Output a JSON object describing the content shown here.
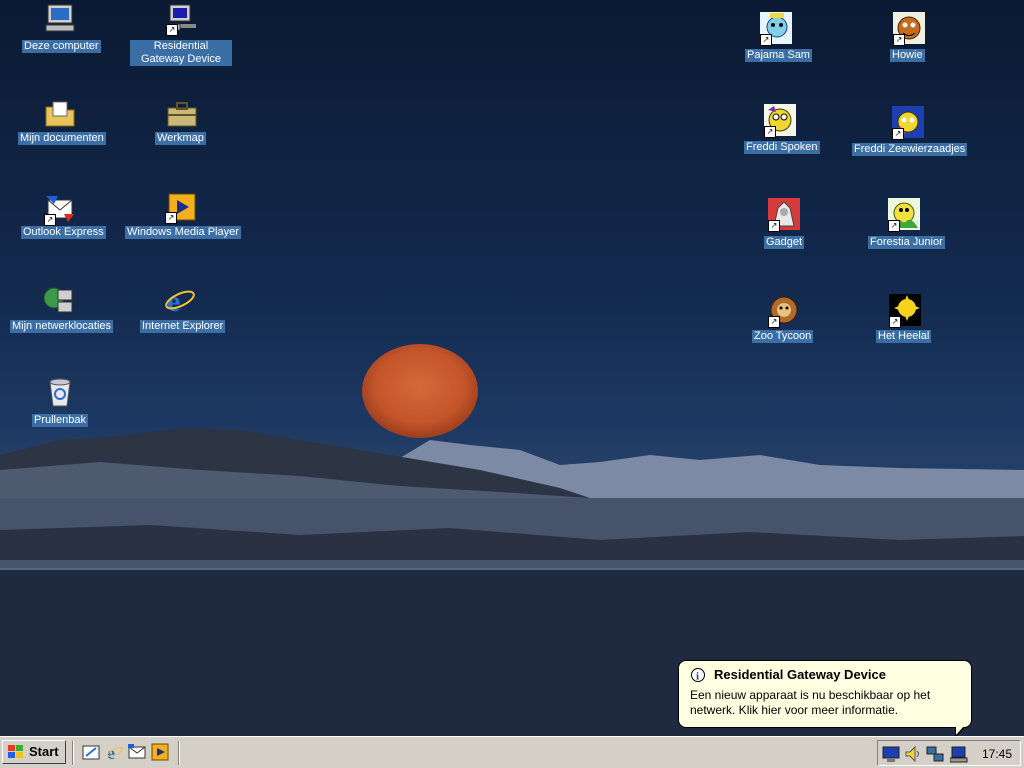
{
  "desktop": {
    "icons": [
      {
        "id": "deze-computer",
        "label": "Deze computer"
      },
      {
        "id": "residential-gateway-device",
        "label": "Residential Gateway Device"
      },
      {
        "id": "mijn-documenten",
        "label": "Mijn documenten"
      },
      {
        "id": "werkmap",
        "label": "Werkmap"
      },
      {
        "id": "outlook-express",
        "label": "Outlook Express"
      },
      {
        "id": "windows-media-player",
        "label": "Windows Media Player"
      },
      {
        "id": "mijn-netwerklocaties",
        "label": "Mijn netwerklocaties"
      },
      {
        "id": "internet-explorer",
        "label": "Internet Explorer"
      },
      {
        "id": "prullenbak",
        "label": "Prullenbak"
      },
      {
        "id": "pajama-sam",
        "label": "Pajama Sam"
      },
      {
        "id": "howie",
        "label": "Howie"
      },
      {
        "id": "freddi-spoken",
        "label": "Freddi Spoken"
      },
      {
        "id": "freddi-zeewierzaadjes",
        "label": "Freddi Zeewierzaadjes"
      },
      {
        "id": "gadget",
        "label": "Gadget"
      },
      {
        "id": "forestia-junior",
        "label": "Forestia Junior"
      },
      {
        "id": "zoo-tycoon",
        "label": "Zoo Tycoon"
      },
      {
        "id": "het-heelal",
        "label": "Het Heelal"
      }
    ]
  },
  "taskbar": {
    "start_label": "Start",
    "clock": "17:45"
  },
  "balloon": {
    "title": "Residential Gateway Device",
    "text": "Een nieuw apparaat is nu beschikbaar op het netwerk. Klik hier voor meer informatie."
  },
  "colors": {
    "taskbar": "#d4d0c8",
    "icon_label_bg": "#3a6ea5",
    "balloon_bg": "#ffffe1"
  }
}
